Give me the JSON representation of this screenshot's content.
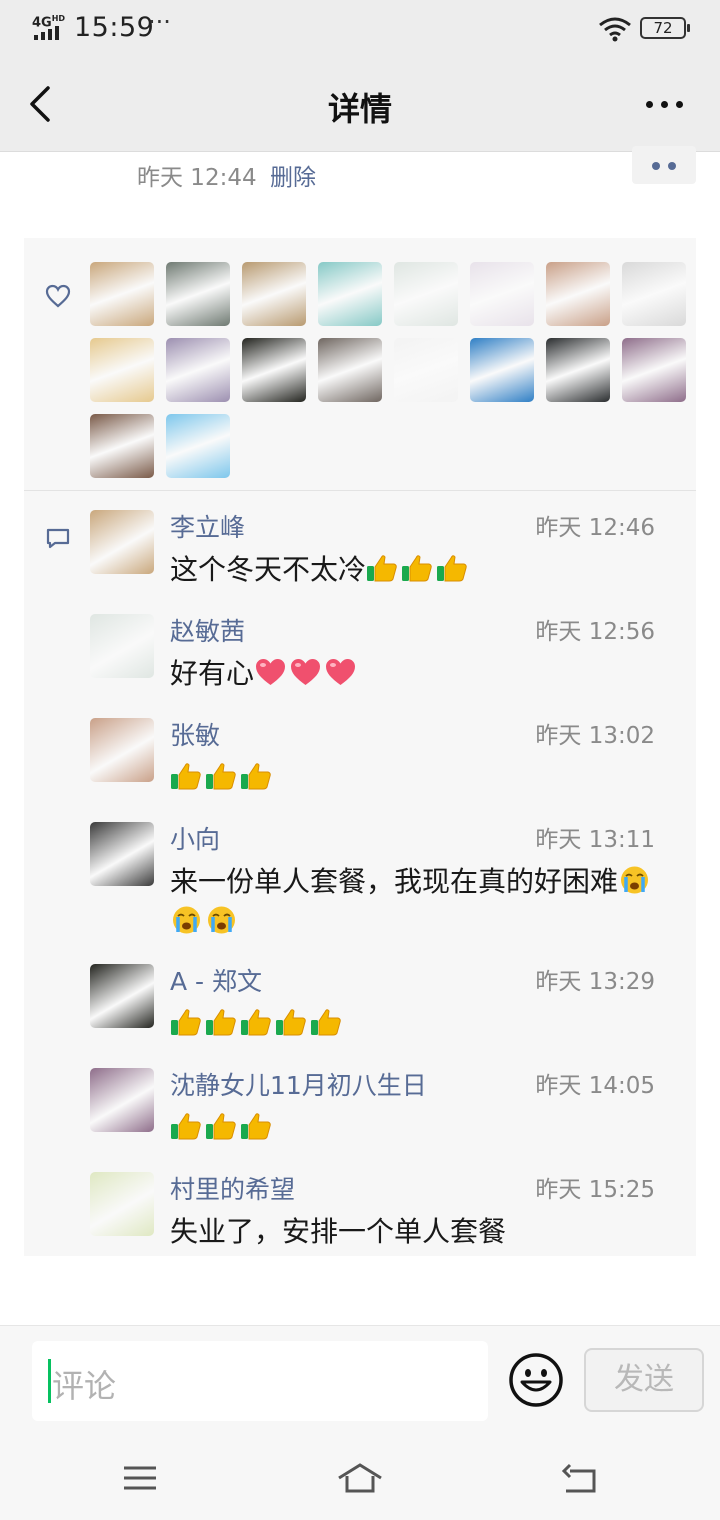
{
  "status_bar": {
    "network": "4G",
    "network_sup": "HD",
    "time": "15:59",
    "more": "···",
    "battery": "72"
  },
  "nav": {
    "title": "详情"
  },
  "post": {
    "time": "昨天 12:44",
    "delete_label": "删除"
  },
  "likes": {
    "avatars": [
      {
        "name": "sunset-man",
        "bg": "#c9a77c"
      },
      {
        "name": "cat-eye",
        "bg": "#6f7a72"
      },
      {
        "name": "cartoon-people",
        "bg": "#b89a70"
      },
      {
        "name": "colorful-beads",
        "bg": "#86c9c6"
      },
      {
        "name": "woman-podium",
        "bg": "#dfe6e2"
      },
      {
        "name": "anime-girl",
        "bg": "#e8e2ea"
      },
      {
        "name": "little-girl",
        "bg": "#c9a088"
      },
      {
        "name": "kitten",
        "bg": "#d9d9d9"
      },
      {
        "name": "monk-cartoon",
        "bg": "#e6c98e"
      },
      {
        "name": "wind-turbine",
        "bg": "#9c8fb0"
      },
      {
        "name": "fireworks-quote",
        "bg": "#23241f"
      },
      {
        "name": "couple-photo",
        "bg": "#6f6660"
      },
      {
        "name": "fashion-figure",
        "bg": "#f3f3f3"
      },
      {
        "name": "news-anchor",
        "bg": "#2f7fc5"
      },
      {
        "name": "man-portrait",
        "bg": "#2a2d2f"
      },
      {
        "name": "girl-outdoor",
        "bg": "#8e6d8a"
      },
      {
        "name": "playground",
        "bg": "#7a5a48"
      },
      {
        "name": "kids-cartoon",
        "bg": "#7ec7ec"
      }
    ]
  },
  "comments": [
    {
      "name": "李立峰",
      "time": "昨天 12:46",
      "text": "这个冬天不太冷",
      "emoji": "thumbs-up",
      "emoji_count": 3,
      "avatar_bg": "#c9a77c"
    },
    {
      "name": "赵敏茜",
      "time": "昨天 12:56",
      "text": "好有心",
      "emoji": "heart",
      "emoji_count": 3,
      "avatar_bg": "#dfe6e2"
    },
    {
      "name": "张敏",
      "time": "昨天 13:02",
      "text": "",
      "emoji": "thumbs-up",
      "emoji_count": 3,
      "avatar_bg": "#c9a088"
    },
    {
      "name": "小向",
      "time": "昨天 13:11",
      "text": "来一份单人套餐，我现在真的好困难",
      "emoji": "crying-face",
      "emoji_count": 3,
      "avatar_bg": "#3a3a3a"
    },
    {
      "name": "A - 郑文",
      "time": "昨天 13:29",
      "text": "",
      "emoji": "thumbs-up",
      "emoji_count": 5,
      "avatar_bg": "#23241f"
    },
    {
      "name": "沈静女儿11月初八生日",
      "time": "昨天 14:05",
      "text": "",
      "emoji": "thumbs-up",
      "emoji_count": 3,
      "avatar_bg": "#8e6d8a"
    },
    {
      "name": "村里的希望",
      "time": "昨天 15:25",
      "text": "失业了，安排一个单人套餐",
      "emoji": "",
      "emoji_count": 0,
      "avatar_bg": "#dfe8c2"
    }
  ],
  "input": {
    "placeholder": "评论",
    "send_label": "发送"
  },
  "colors": {
    "link_blue": "#576b95",
    "accent_green": "#07c160"
  }
}
